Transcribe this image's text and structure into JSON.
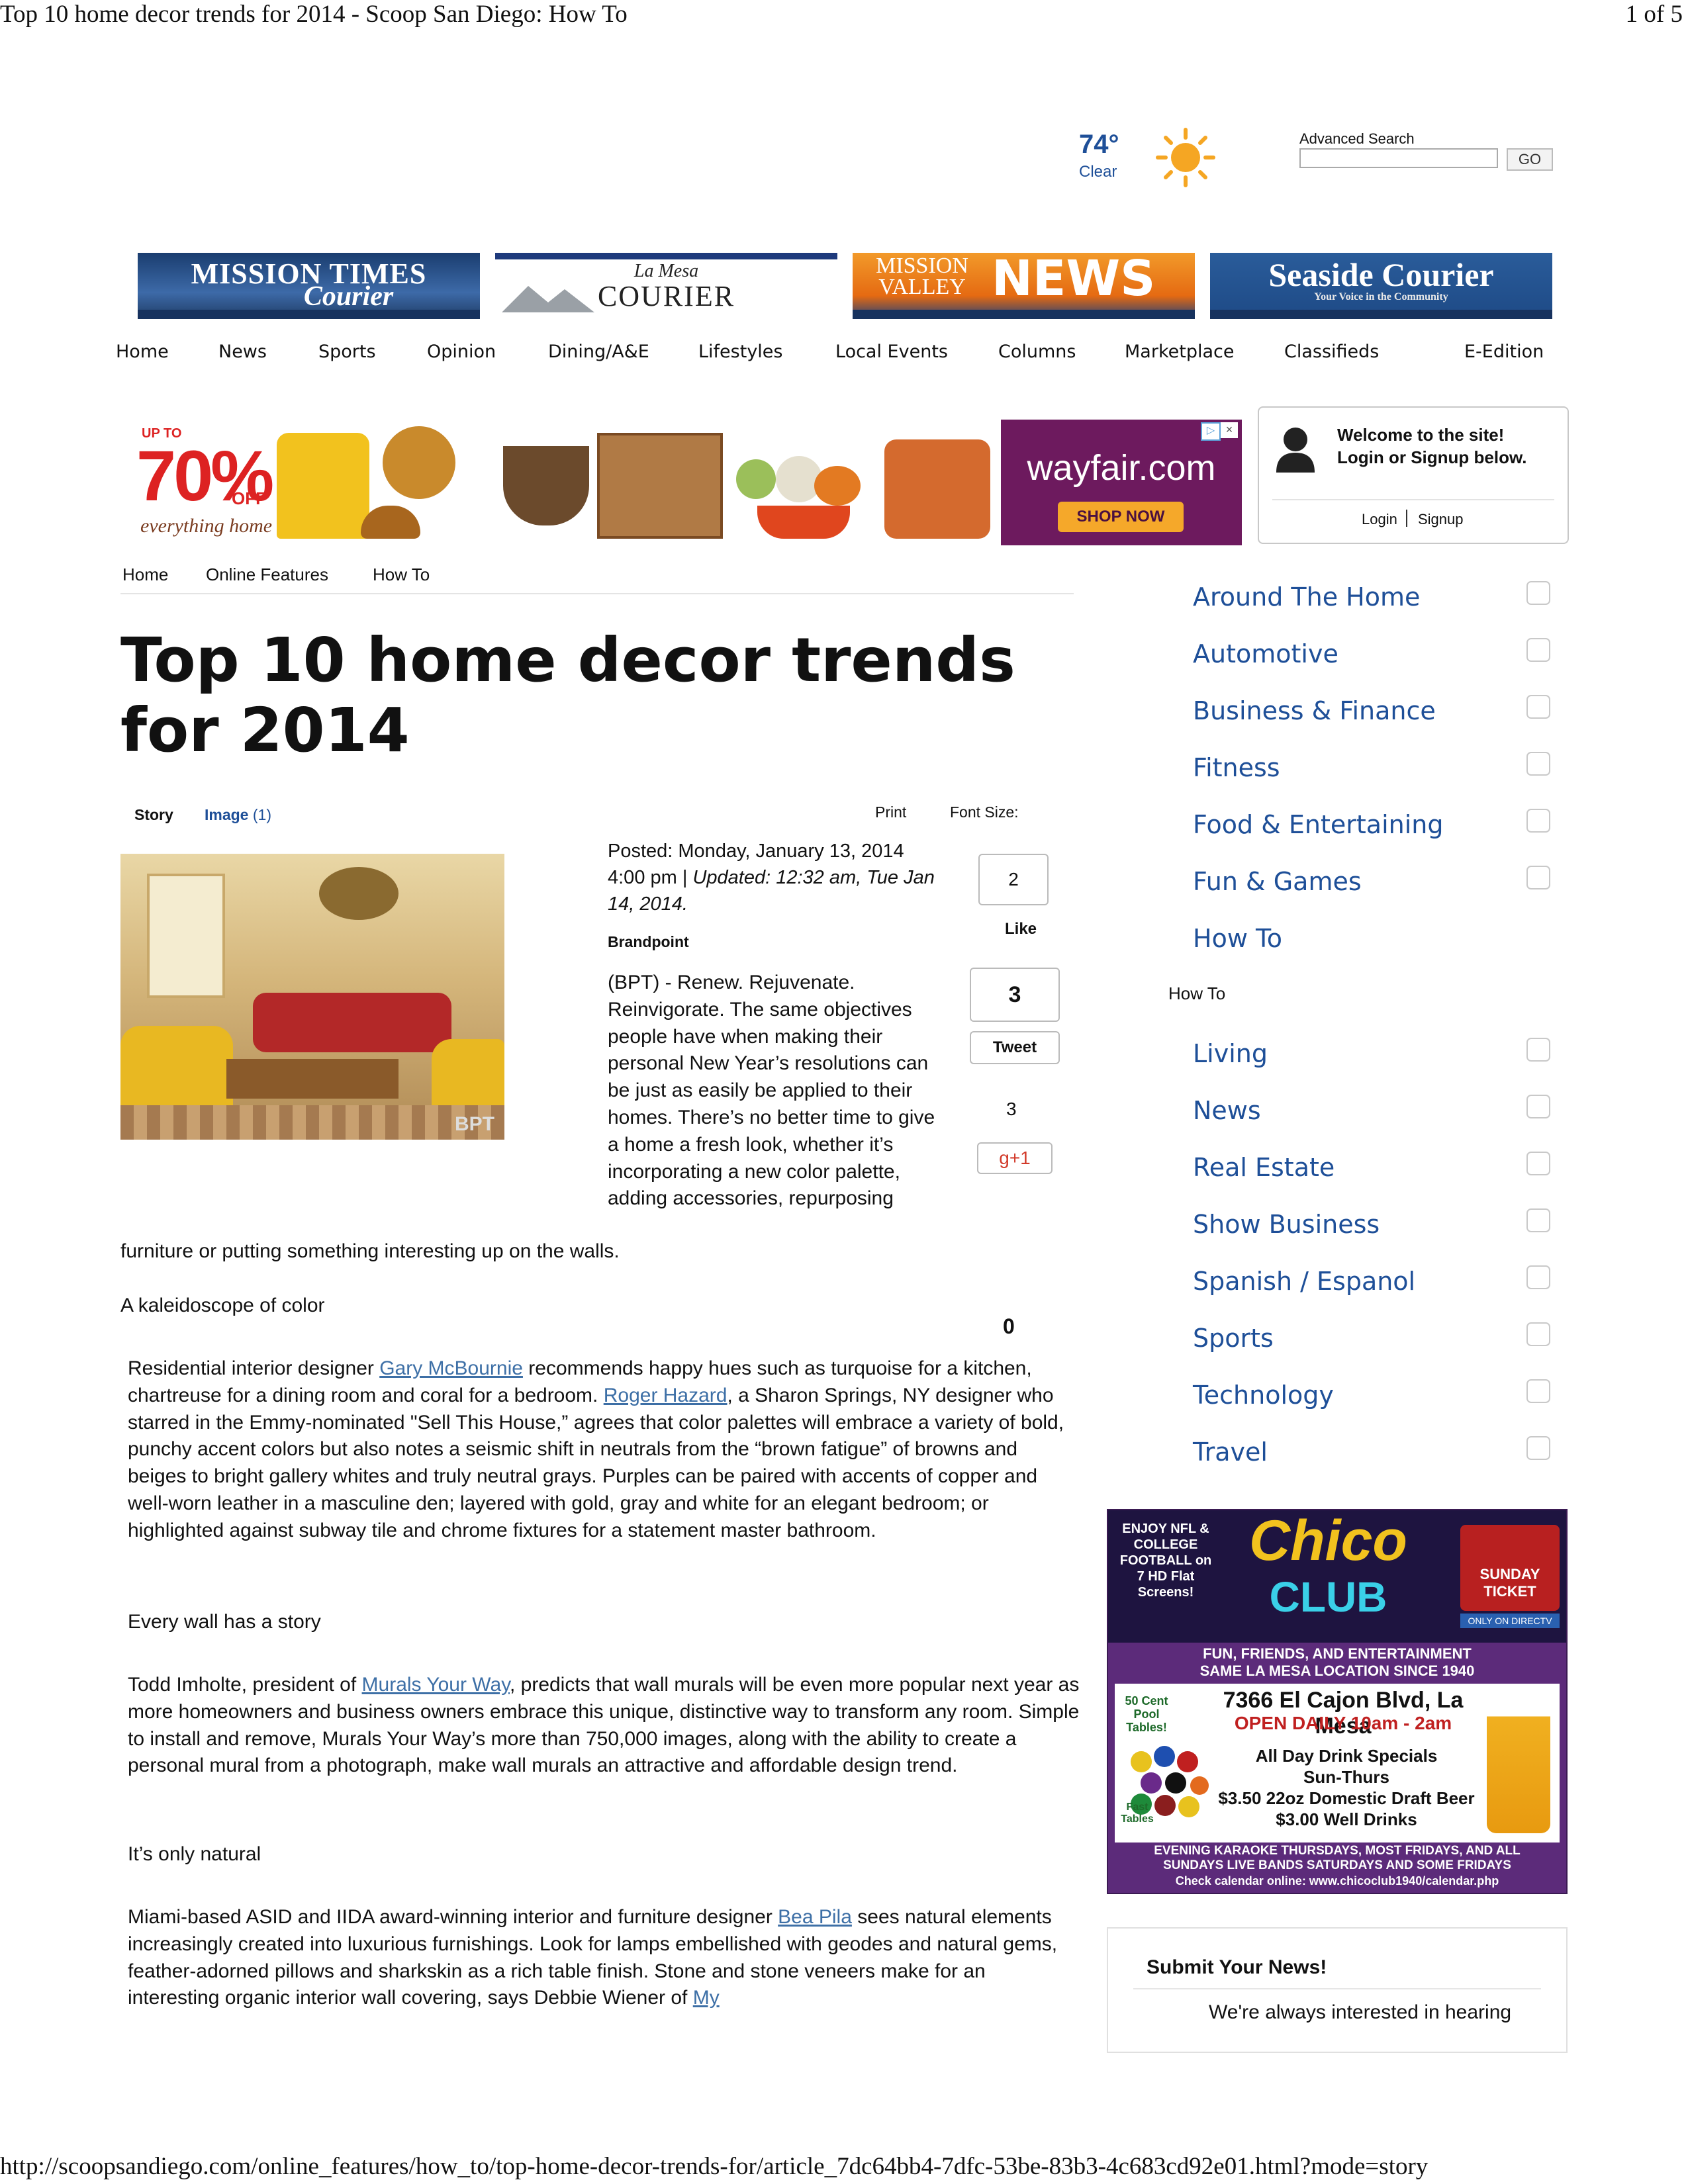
{
  "print_header": {
    "title": "Top 10 home decor trends for 2014 - Scoop San Diego: How To",
    "page": "1 of 5"
  },
  "print_footer": {
    "url": "http://scoopsandiego.com/online_features/how_to/top-home-decor-trends-for/article_7dc64bb4-7dfc-53be-83b3-4c683cd92e01.html?mode=story"
  },
  "weather": {
    "temp": "74°",
    "condition": "Clear",
    "icon": "sun-icon"
  },
  "search": {
    "label": "Advanced Search",
    "placeholder": "",
    "button": "GO"
  },
  "mastheads": [
    {
      "title": "MISSION TIMES",
      "subtitle": "Courier"
    },
    {
      "title": "COURIER",
      "subtitle": "La Mesa"
    },
    {
      "title": "NEWS",
      "subtitle": "MISSION VALLEY"
    },
    {
      "title": "Seaside Courier",
      "subtitle": "Your Voice in the Community"
    }
  ],
  "nav": [
    "Home",
    "News",
    "Sports",
    "Opinion",
    "Dining/A&E",
    "Lifestyles",
    "Local Events",
    "Columns",
    "Marketplace",
    "Classifieds",
    "E-Edition"
  ],
  "ad_banner": {
    "upto": "UP TO",
    "percent": "70%",
    "off": "OFF",
    "tagline": "everything home",
    "brand": "wayfair.com",
    "cta": "SHOP NOW"
  },
  "login": {
    "welcome": "Welcome to the site!",
    "prompt": "Login or Signup below.",
    "login": "Login",
    "signup": "Signup"
  },
  "breadcrumb": [
    "Home",
    "Online Features",
    "How To"
  ],
  "article": {
    "title": "Top 10 home decor trends for 2014",
    "tabs": {
      "story": "Story",
      "image": "Image",
      "image_count": "(1)",
      "print": "Print",
      "font_size": "Font Size:"
    },
    "photo_credit": "BPT",
    "posted": "Posted: Monday, January 13, 2014 4:00 pm",
    "updated": "Updated: 12:32 am, Tue Jan 14, 2014.",
    "byline": "Brandpoint",
    "lede": "(BPT) - Renew. Rejuvenate. Reinvigorate. The same objectives people have when making their personal New Year’s resolutions can be just as easily be applied to their homes. There’s no better time to give a home a fresh look, whether it’s incorporating a new color palette, adding accessories, repurposing",
    "lede_end": "furniture or putting something interesting up on the walls.",
    "h1": "A kaleidoscope of color",
    "p1_a": "Residential interior designer ",
    "p1_link1": "Gary McBournie",
    "p1_b": " recommends happy hues such as turquoise for a kitchen, chartreuse for a dining room and coral for a bedroom. ",
    "p1_link2": "Roger Hazard",
    "p1_c": ", a Sharon Springs, NY designer who starred in the Emmy-nominated \"Sell This House,” agrees that color palettes will embrace a variety of bold, punchy accent colors but also notes a seismic shift in neutrals from the “brown fatigue” of browns and beiges to bright gallery whites and truly neutral grays. Purples can be paired with accents of copper and well-worn leather in a masculine den; layered with gold, gray and white for an elegant bedroom; or highlighted against subway tile and chrome fixtures for a statement master bathroom.",
    "h2": "Every wall has a story",
    "p2_a": "Todd Imholte, president of ",
    "p2_link": "Murals Your Way",
    "p2_b": ", predicts that wall murals will be even more popular next year as more homeowners and business owners embrace this unique, distinctive way to transform any room. Simple to install and remove, Murals Your Way’s more than 750,000 images, along with the ability to create a personal mural from a photograph, make wall murals an attractive and affordable design trend.",
    "h3": "It’s only natural",
    "p3_a": "Miami-based ASID and IIDA award-winning interior and furniture designer ",
    "p3_link1": "Bea Pila",
    "p3_b": " sees natural elements increasingly created into luxurious furnishings. Look for lamps embellished with geodes and natural gems, feather-adorned pillows and sharkskin as a rich table finish. Stone and stone veneers make for an interesting organic interior wall covering, says Debbie Wiener of ",
    "p3_link2": "My"
  },
  "social": {
    "like_count": "2",
    "like_label": "Like",
    "tweet_count": "3",
    "tweet_label": "Tweet",
    "plus_count": "3",
    "plus_label": "g+1",
    "other_count": "0"
  },
  "sidebar": {
    "items": [
      "Around The Home",
      "Automotive",
      "Business & Finance",
      "Fitness",
      "Food & Entertaining",
      "Fun & Games",
      "How To"
    ],
    "sub_label": "How To",
    "items2": [
      "Living",
      "News",
      "Real Estate",
      "Show Business",
      "Spanish / Espanol",
      "Sports",
      "Technology",
      "Travel"
    ]
  },
  "chico_ad": {
    "left": "ENJOY NFL & COLLEGE FOOTBALL on 7 HD Flat Screens!",
    "logo1": "Chico",
    "logo2": "CLUB",
    "badge": "SUNDAY TICKET",
    "badge_sub": "ONLY ON DIRECTV",
    "tag": "FUN, FRIENDS, AND ENTERTAINMENT SAME LA MESA LOCATION SINCE 1940",
    "address": "7366 El Cajon Blvd, La Mesa",
    "hours": "OPEN DAILY 10am - 2am",
    "pool": "50 Cent Pool Tables!",
    "specials1": "All Day Drink Specials",
    "specials2": "Sun-Thurs",
    "specials3": "$3.50 22oz Domestic Draft Beer",
    "specials4": "$3.00 Well Drinks",
    "fast": "Fast Tables",
    "karaoke": "EVENING KARAOKE THURSDAYS, MOST FRIDAYS, AND ALL SUNDAYS LIVE BANDS SATURDAYS AND SOME FRIDAYS",
    "calendar": "Check calendar online: www.chicoclub1940/calendar.php"
  },
  "submit": {
    "title": "Submit Your News!",
    "text": "We're always interested in hearing"
  },
  "colors": {
    "link": "#1e4f98",
    "accent_orange": "#f5a623",
    "wayfair_purple": "#6d1a5e",
    "chico_purple": "#5c2b7a"
  }
}
